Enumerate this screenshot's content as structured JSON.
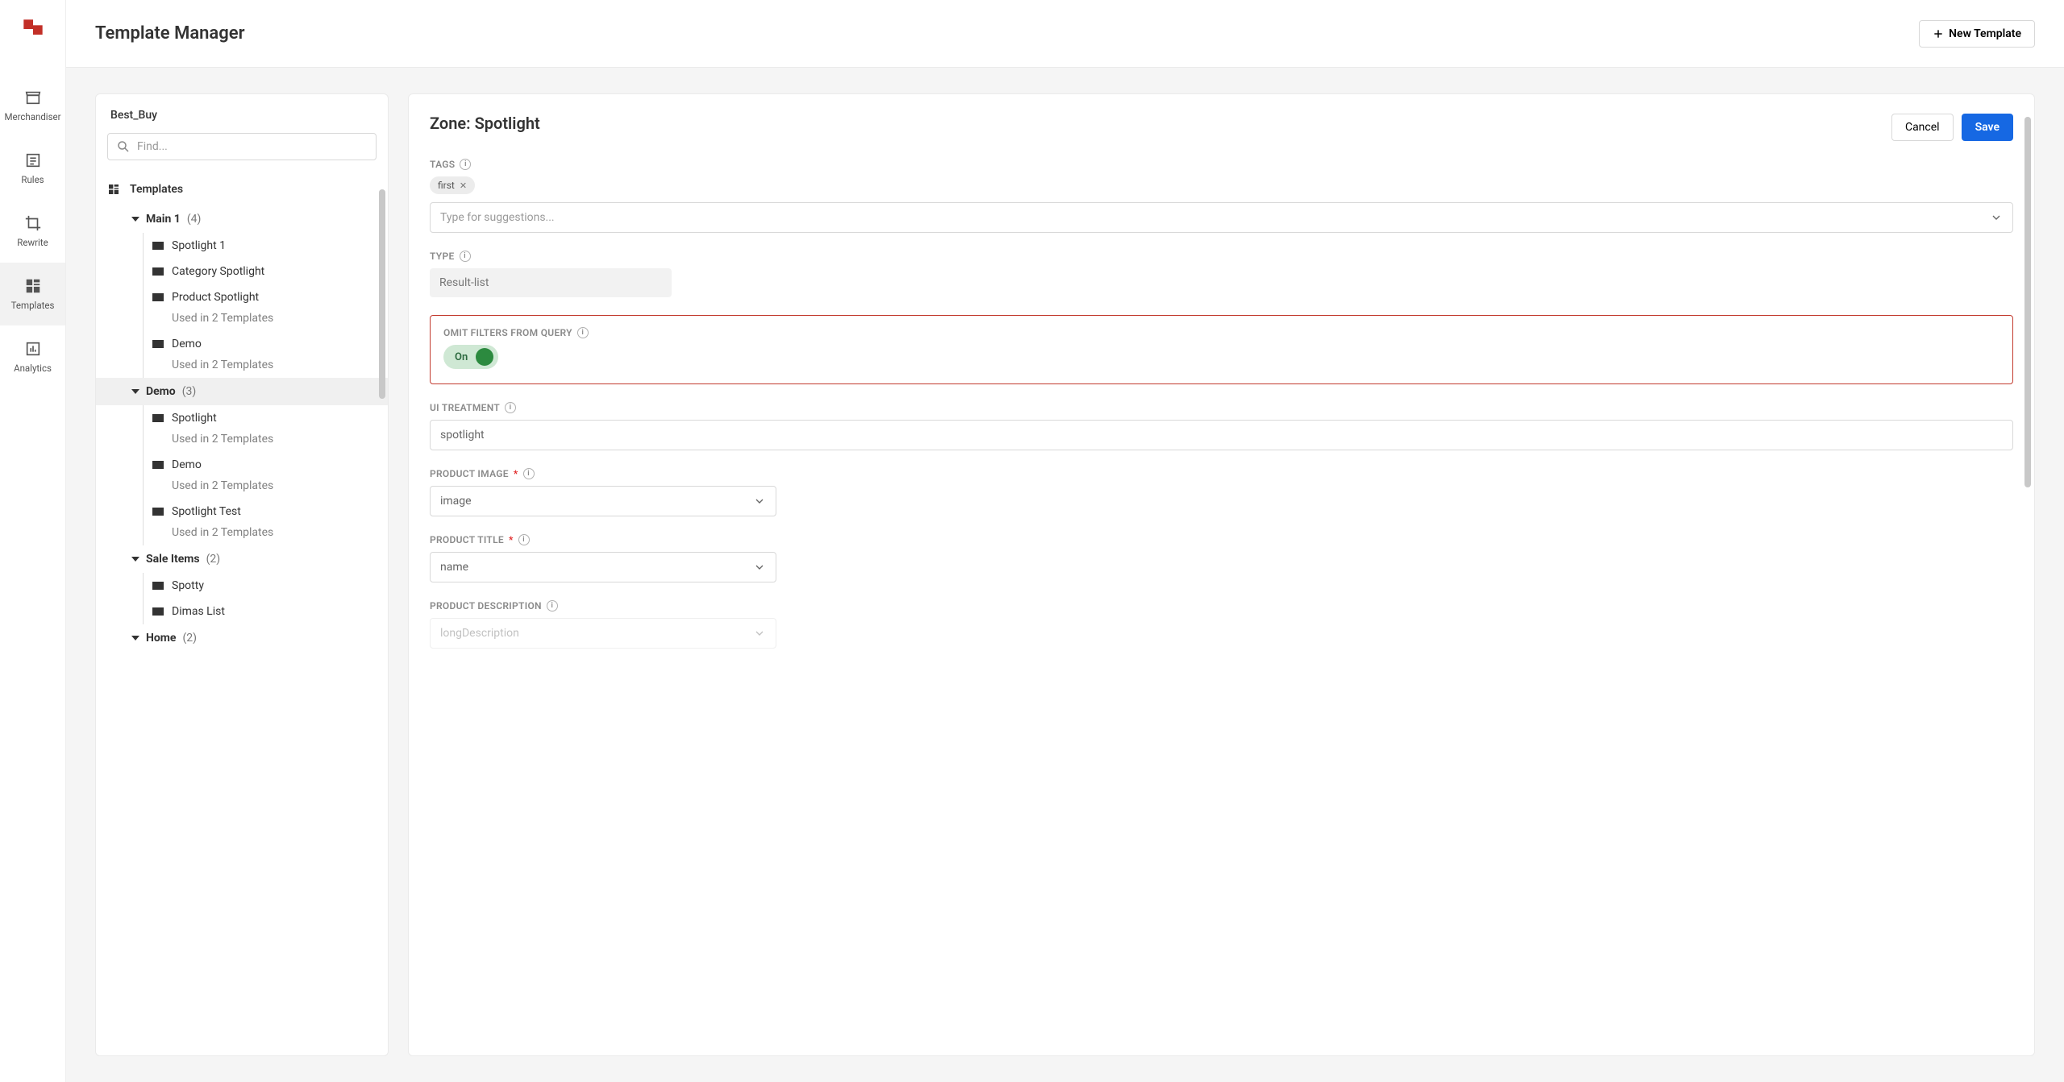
{
  "header": {
    "title": "Template Manager",
    "new_btn": "New Template"
  },
  "rail": {
    "merchandiser": "Merchandiser",
    "rules": "Rules",
    "rewrite": "Rewrite",
    "templates": "Templates",
    "analytics": "Analytics"
  },
  "tree": {
    "project": "Best_Buy",
    "search_ph": "Find...",
    "templates_hdr": "Templates",
    "used_label": "Used in 2 Templates",
    "groups": [
      {
        "name": "Main 1",
        "count": "(4)",
        "items": [
          {
            "label": "Spotlight 1"
          },
          {
            "label": "Category Spotlight"
          },
          {
            "label": "Product Spotlight",
            "used": true
          },
          {
            "label": "Demo",
            "used": true
          }
        ]
      },
      {
        "name": "Demo",
        "count": "(3)",
        "active": true,
        "items": [
          {
            "label": "Spotlight",
            "used": true
          },
          {
            "label": "Demo",
            "used": true
          },
          {
            "label": "Spotlight Test",
            "used": true
          }
        ]
      },
      {
        "name": "Sale Items",
        "count": "(2)",
        "items": [
          {
            "label": "Spotty"
          },
          {
            "label": "Dimas List"
          }
        ]
      },
      {
        "name": "Home",
        "count": "(2)",
        "items": []
      }
    ]
  },
  "detail": {
    "title": "Zone: Spotlight",
    "cancel": "Cancel",
    "save": "Save",
    "tags_label": "TAGS",
    "tag_value": "first",
    "tags_ph": "Type for suggestions...",
    "type_label": "TYPE",
    "type_value": "Result-list",
    "omit_label": "OMIT FILTERS FROM QUERY",
    "omit_value": "On",
    "ui_label": "UI TREATMENT",
    "ui_value": "spotlight",
    "pimg_label": "PRODUCT IMAGE",
    "pimg_value": "image",
    "ptitle_label": "PRODUCT TITLE",
    "ptitle_value": "name",
    "pdesc_label": "PRODUCT DESCRIPTION",
    "pdesc_value": "longDescription"
  }
}
